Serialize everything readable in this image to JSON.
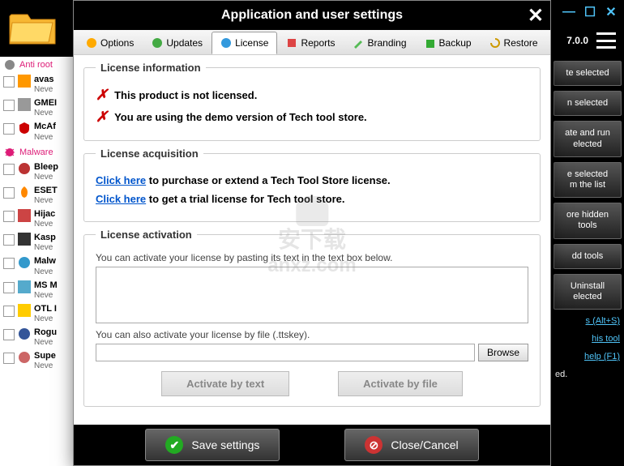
{
  "app": {
    "version": "7.0.0"
  },
  "sidebar_left": {
    "section1": "Anti root",
    "section2": "Malware",
    "tools": [
      {
        "name": "avas",
        "sub": "Neve"
      },
      {
        "name": "GMEI",
        "sub": "Neve"
      },
      {
        "name": "McAf",
        "sub": "Neve"
      },
      {
        "name": "Bleep",
        "sub": "Neve"
      },
      {
        "name": "ESET",
        "sub": "Neve"
      },
      {
        "name": "Hijac",
        "sub": "Neve"
      },
      {
        "name": "Kasp",
        "sub": "Neve"
      },
      {
        "name": "Malw",
        "sub": "Neve"
      },
      {
        "name": "MS M",
        "sub": "Neve"
      },
      {
        "name": "OTL I",
        "sub": "Neve"
      },
      {
        "name": "Rogu",
        "sub": "Neve"
      },
      {
        "name": "Supe",
        "sub": "Neve"
      }
    ]
  },
  "sidebar_right": {
    "buttons": [
      "te selected",
      "n selected",
      "ate and run\nelected",
      "e selected\nm the list",
      "ore hidden\ntools",
      "dd tools",
      "Uninstall\nelected"
    ],
    "links": [
      "s (Alt+S)",
      "his tool",
      "help (F1)"
    ],
    "text": "ed."
  },
  "modal": {
    "title": "Application and user settings",
    "tabs": [
      "Options",
      "Updates",
      "License",
      "Reports",
      "Branding",
      "Backup",
      "Restore"
    ],
    "license_info": {
      "legend": "License information",
      "line1": "This product is not licensed.",
      "line2": "You are using the demo version of Tech tool store."
    },
    "license_acq": {
      "legend": "License acquisition",
      "link": "Click here",
      "line1_rest": " to purchase or extend a Tech Tool Store license.",
      "line2_rest": " to get a trial license for Tech tool store."
    },
    "license_act": {
      "legend": "License activation",
      "label1": "You can activate your license by pasting its text in the text box below.",
      "label2": "You can also activate your license by file (.ttskey).",
      "browse": "Browse",
      "btn1": "Activate by text",
      "btn2": "Activate by file"
    },
    "footer": {
      "save": "Save settings",
      "cancel": "Close/Cancel"
    }
  },
  "watermark": "anxz.com",
  "watermark_cn": "安下载"
}
